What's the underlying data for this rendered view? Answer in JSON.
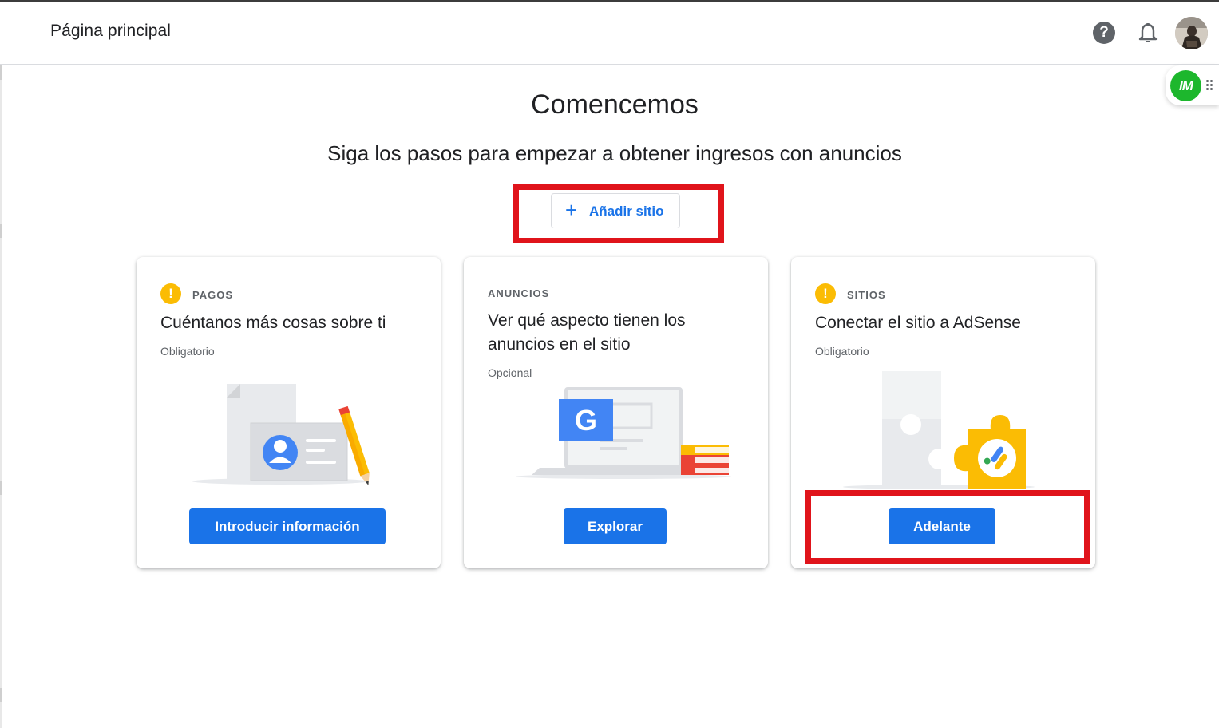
{
  "header": {
    "title": "Página principal",
    "help_icon": "help-circle-icon",
    "notifications_icon": "bell-icon",
    "avatar_icon": "user-avatar",
    "extension_logo": "IM"
  },
  "hero": {
    "title": "Comencemos",
    "subtitle": "Siga los pasos para empezar a obtener ingresos con anuncios",
    "add_site_label": "Añadir sitio",
    "add_site_icon": "plus-icon"
  },
  "cards": [
    {
      "eyebrow": "PAGOS",
      "title": "Cuéntanos más cosas sobre ti",
      "status": "Obligatorio",
      "button": "Introducir información",
      "icon": "warning-icon"
    },
    {
      "eyebrow": "ANUNCIOS",
      "title": "Ver qué aspecto tienen los anuncios en el sitio",
      "status": "Opcional",
      "button": "Explorar"
    },
    {
      "eyebrow": "SITIOS",
      "title": "Conectar el sitio a AdSense",
      "status": "Obligatorio",
      "button": "Adelante",
      "icon": "warning-icon"
    }
  ],
  "colors": {
    "primary_blue": "#1a73e8",
    "warning_yellow": "#fbbc04",
    "highlight_red": "#e0141b",
    "extension_green": "#1db72d"
  }
}
